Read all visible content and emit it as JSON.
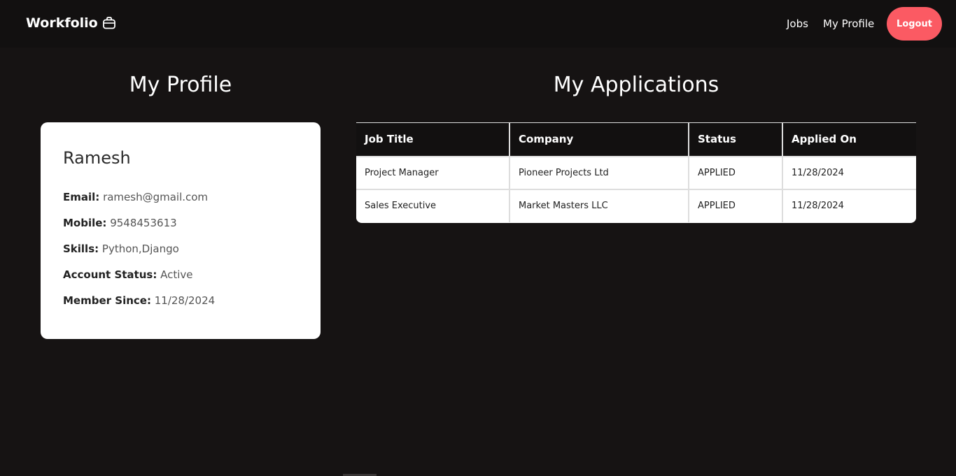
{
  "navbar": {
    "brand": "Workfolio",
    "brand_icon": "briefcase-icon",
    "links": [
      "Jobs",
      "My Profile"
    ],
    "logout_label": "Logout",
    "logout_color": "#fb5a63"
  },
  "profile": {
    "heading": "My Profile",
    "name": "Ramesh",
    "email_label": "Email:",
    "email": "ramesh@gmail.com",
    "mobile_label": "Mobile:",
    "mobile": "9548453613",
    "skills_label": "Skills:",
    "skills": "Python,Django",
    "status_label": "Account Status:",
    "status": "Active",
    "member_label": "Member Since:",
    "member_since": "11/28/2024"
  },
  "applications": {
    "heading": "My Applications",
    "columns": [
      "Job Title",
      "Company",
      "Status",
      "Applied On"
    ],
    "rows": [
      [
        "Project Manager",
        "Pioneer Projects Ltd",
        "APPLIED",
        "11/28/2024"
      ],
      [
        "Sales Executive",
        "Market Masters LLC",
        "APPLIED",
        "11/28/2024"
      ]
    ]
  }
}
